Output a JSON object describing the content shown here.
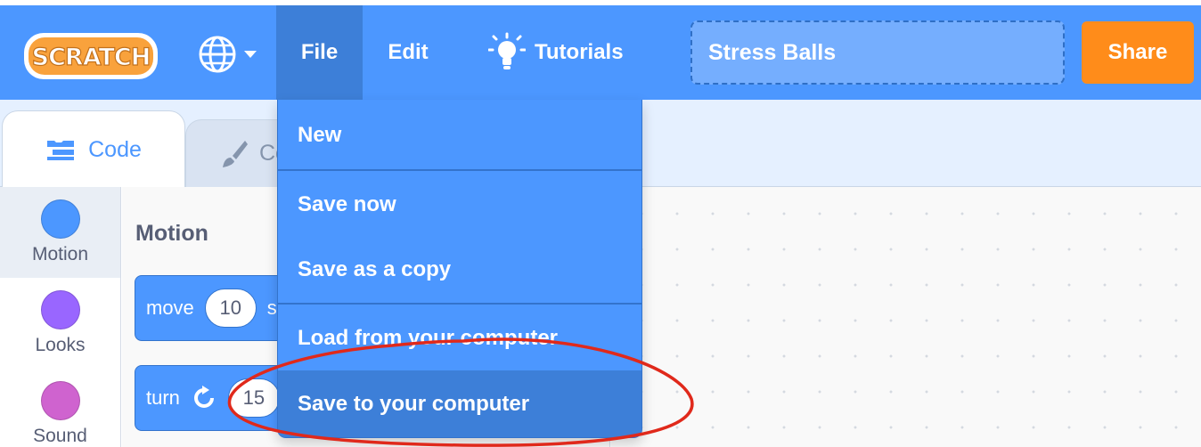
{
  "app": {
    "logo_text": "SCRATCH",
    "colors": {
      "menubar": "#4c97ff",
      "share": "#ff8c1a",
      "motion": "#4c97ff",
      "looks": "#9966ff",
      "sound": "#cf63cf",
      "annotation": "#e0291b"
    }
  },
  "menubar": {
    "language_icon": "globe-icon",
    "file_label": "File",
    "edit_label": "Edit",
    "tutorials_label": "Tutorials",
    "tutorials_icon": "lightbulb-icon",
    "project_title": "Stress Balls",
    "share_label": "Share"
  },
  "tabs": {
    "code_label": "Code",
    "code_icon": "code-blocks-icon",
    "costumes_label": "Costumes",
    "costumes_icon": "brush-icon"
  },
  "categories": [
    {
      "label": "Motion",
      "color": "#4c97ff"
    },
    {
      "label": "Looks",
      "color": "#9966ff"
    },
    {
      "label": "Sound",
      "color": "#cf63cf"
    }
  ],
  "palette": {
    "heading": "Motion",
    "blocks": [
      {
        "label": "move",
        "value": "10",
        "suffix": "steps"
      },
      {
        "label": "turn",
        "value": "15",
        "icon": "rotate-clockwise-icon"
      }
    ]
  },
  "file_menu": {
    "items": [
      {
        "label": "New"
      },
      {
        "label": "Save now"
      },
      {
        "label": "Save as a copy"
      },
      {
        "label": "Load from your computer"
      },
      {
        "label": "Save to your computer",
        "highlighted": true
      }
    ]
  }
}
